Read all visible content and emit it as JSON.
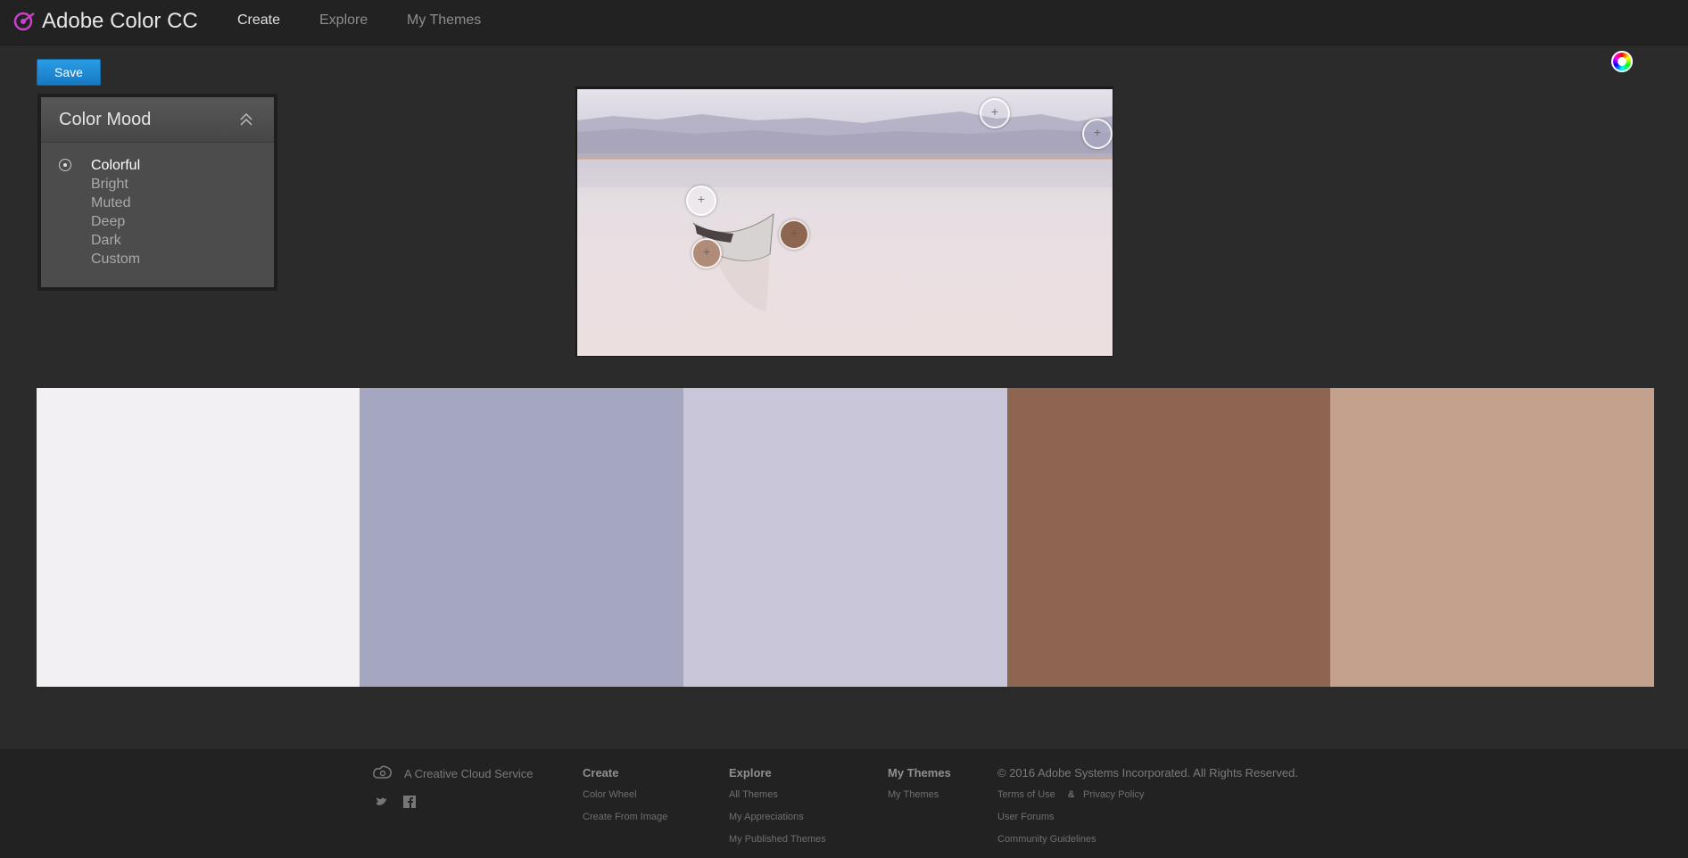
{
  "header": {
    "app_title": "Adobe Color CC",
    "nav": [
      {
        "label": "Create",
        "active": true
      },
      {
        "label": "Explore",
        "active": false
      },
      {
        "label": "My Themes",
        "active": false
      }
    ],
    "logo_icon": "color-target-icon",
    "color_wheel_icon": "color-wheel-icon"
  },
  "toolbar": {
    "save_label": "Save"
  },
  "color_mood": {
    "title": "Color Mood",
    "options": [
      "Colorful",
      "Bright",
      "Muted",
      "Deep",
      "Dark",
      "Custom"
    ],
    "selected": "Colorful"
  },
  "swatches": [
    "#f2f0f2",
    "#a5a6bf",
    "#c8c6d8",
    "#8e6551",
    "#c4a18c"
  ],
  "footer": {
    "service_text": "A Creative Cloud Service",
    "create": {
      "heading": "Create",
      "links": [
        "Color Wheel",
        "Create From Image"
      ]
    },
    "explore": {
      "heading": "Explore",
      "links": [
        "All Themes",
        "My Appreciations",
        "My Published Themes"
      ]
    },
    "my_themes": {
      "heading": "My Themes",
      "links": [
        "My Themes"
      ]
    },
    "copyright": "© 2016 Adobe Systems Incorporated. All Rights Reserved.",
    "terms": "Terms of Use",
    "amp": "&",
    "privacy": "Privacy Policy",
    "user_forums": "User Forums",
    "community": "Community Guidelines"
  },
  "colors": {
    "accent": "#1e8fdb",
    "brand": "#c940c9"
  }
}
